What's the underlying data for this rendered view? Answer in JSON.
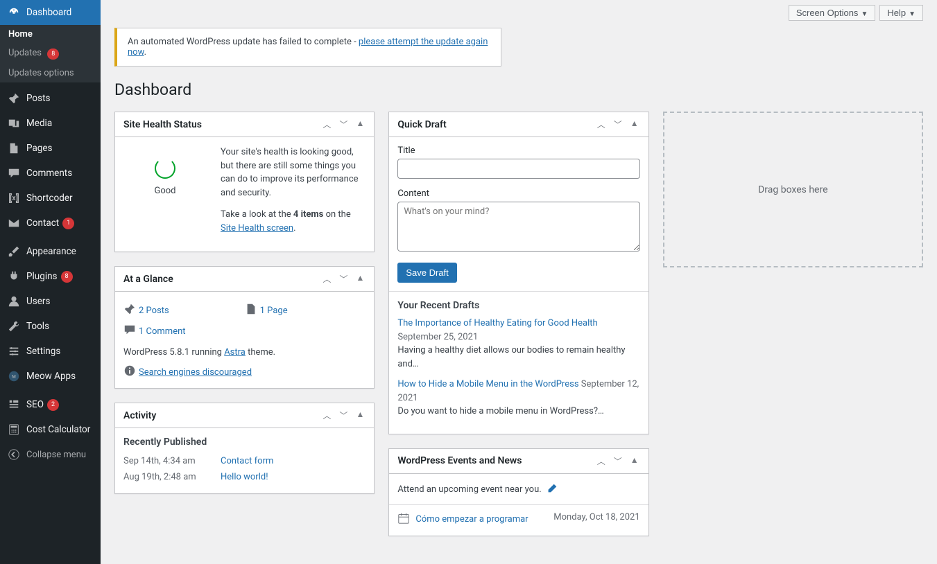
{
  "topbar": {
    "screen_options": "Screen Options",
    "help": "Help"
  },
  "notice": {
    "text": "An automated WordPress update has failed to complete - ",
    "link": "please attempt the update again now",
    "suffix": "."
  },
  "page_title": "Dashboard",
  "sidebar": {
    "dashboard": "Dashboard",
    "home": "Home",
    "updates": "Updates",
    "updates_badge": "8",
    "updates_options": "Updates options",
    "posts": "Posts",
    "media": "Media",
    "pages": "Pages",
    "comments": "Comments",
    "shortcoder": "Shortcoder",
    "contact": "Contact",
    "contact_badge": "1",
    "appearance": "Appearance",
    "plugins": "Plugins",
    "plugins_badge": "8",
    "users": "Users",
    "tools": "Tools",
    "settings": "Settings",
    "meow": "Meow Apps",
    "seo": "SEO",
    "seo_badge": "2",
    "cost": "Cost Calculator",
    "collapse": "Collapse menu"
  },
  "health": {
    "title": "Site Health Status",
    "status": "Good",
    "desc": "Your site's health is looking good, but there are still some things you can do to improve its performance and security.",
    "line2_pre": "Take a look at the ",
    "line2_bold": "4 items",
    "line2_mid": " on the ",
    "line2_link": "Site Health screen",
    "line2_suf": "."
  },
  "glance": {
    "title": "At a Glance",
    "posts": "2 Posts",
    "pages": "1 Page",
    "comments": "1 Comment",
    "version_pre": "WordPress 5.8.1 running ",
    "theme": "Astra",
    "version_suf": " theme.",
    "search": "Search engines discouraged"
  },
  "activity": {
    "title": "Activity",
    "recent": "Recently Published",
    "rows": [
      {
        "date": "Sep 14th, 4:34 am",
        "link": "Contact form"
      },
      {
        "date": "Aug 19th, 2:48 am",
        "link": "Hello world!"
      }
    ]
  },
  "quickdraft": {
    "title": "Quick Draft",
    "title_label": "Title",
    "content_label": "Content",
    "placeholder": "What's on your mind?",
    "save": "Save Draft",
    "recent_title": "Your Recent Drafts",
    "drafts": [
      {
        "link": "The Importance of Healthy Eating for Good Health",
        "date": "September 25, 2021",
        "excerpt": "Having a healthy diet allows our bodies to remain healthy and…"
      },
      {
        "link": "How to Hide a Mobile Menu in the WordPress",
        "date": "September 12, 2021",
        "excerpt": "Do you want to hide a mobile menu in WordPress?…"
      }
    ]
  },
  "events": {
    "title": "WordPress Events and News",
    "attend": "Attend an upcoming event near you.",
    "rows": [
      {
        "link": "Cómo empezar a programar",
        "date": "Monday, Oct 18, 2021"
      }
    ]
  },
  "dropzone": "Drag boxes here"
}
